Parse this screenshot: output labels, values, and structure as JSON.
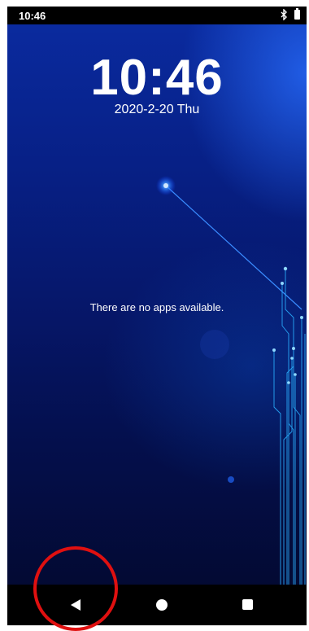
{
  "status_bar": {
    "time": "10:46",
    "icons": [
      "bluetooth-icon",
      "battery-icon"
    ]
  },
  "lockscreen": {
    "clock": "10:46",
    "date": "2020-2-20 Thu",
    "empty_message": "There are no apps available."
  },
  "nav_bar": {
    "buttons": [
      {
        "name": "back",
        "icon": "back-triangle-icon"
      },
      {
        "name": "home",
        "icon": "home-circle-icon"
      },
      {
        "name": "recents",
        "icon": "recents-square-icon"
      }
    ]
  },
  "annotation": {
    "highlight_color": "#e01010",
    "highlight_target": "back"
  },
  "colors": {
    "wallpaper_top": "#0a2a9e",
    "wallpaper_bottom": "#030a33",
    "accent_glow": "#4fa3ff"
  }
}
